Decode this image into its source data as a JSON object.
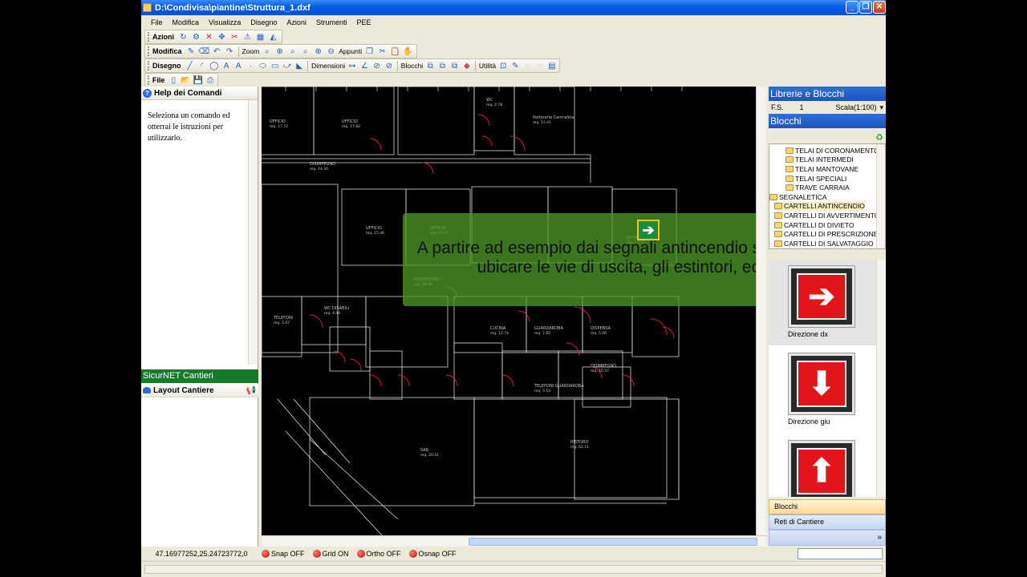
{
  "window": {
    "title": "D:\\Condivisa\\piantine\\Struttura_1.dxf"
  },
  "menu": [
    "File",
    "Modifica",
    "Visualizza",
    "Disegno",
    "Azioni",
    "Strumenti",
    "PEE"
  ],
  "toolbars": {
    "azioni": "Azioni",
    "modifica": "Modifica",
    "zoom": "Zoom",
    "appunti": "Appunti",
    "disegno": "Disegno",
    "dimensioni": "Dimensioni",
    "blocchi": "Blocchi",
    "utilita": "Utilità",
    "file": "File"
  },
  "help": {
    "title": "Help dei Comandi",
    "text": "Seleziona un comando ed otterrai le istruzioni per utilizzarlo."
  },
  "sicurnet": {
    "title": "SicurNET Cantieri",
    "layout": "Layout Cantiere"
  },
  "overlay": {
    "text": "A partire ad esempio dai segnali antincendio si possono ubicare le vie di uscita, gli estintori, ecc."
  },
  "library": {
    "title": "Librerie e Blocchi",
    "fs_label": "F.S.",
    "fs_value": "1",
    "scale": "Scala(1:100)",
    "blocks_title": "Blocchi",
    "tree": [
      {
        "label": "TELAI DI CORONAMENTO",
        "indent": 2
      },
      {
        "label": "TELAI INTERMEDI",
        "indent": 2
      },
      {
        "label": "TELAI MANTOVANE",
        "indent": 2
      },
      {
        "label": "TELAI SPECIALI",
        "indent": 2
      },
      {
        "label": "TRAVE CARRAIA",
        "indent": 2
      },
      {
        "label": "SEGNALETICA",
        "indent": 0
      },
      {
        "label": "CARTELLI ANTINCENDIO",
        "indent": 1,
        "selected": true
      },
      {
        "label": "CARTELLI DI AVVERTIMENTO",
        "indent": 1
      },
      {
        "label": "CARTELLI DI DIVIETO",
        "indent": 1
      },
      {
        "label": "CARTELLI DI PRESCRIZIONE",
        "indent": 1
      },
      {
        "label": "CARTELLI DI SALVATAGGIO",
        "indent": 1
      }
    ],
    "items": [
      {
        "label": "Direzione dx",
        "icon": "arrow-right-icon"
      },
      {
        "label": "Direzione giu",
        "icon": "arrow-down-icon"
      },
      {
        "label": "",
        "icon": "arrow-up-icon"
      }
    ],
    "tab_blocchi": "Blocchi",
    "tab_reti": "Reti di Cantiere"
  },
  "status": {
    "coords": "47.16977252,25.24723772,0",
    "snap": "Snap OFF",
    "grid": "Grid ON",
    "ortho": "Ortho OFF",
    "osnap": "Osnap OFF"
  },
  "cad_labels": [
    {
      "t": "UFFICIO",
      "s": "mq. 17.72"
    },
    {
      "t": "UFFICIO",
      "s": "mq. 17.82"
    },
    {
      "t": "WC",
      "s": "mq. 2.78"
    },
    {
      "t": "Portineria Centralino",
      "s": "mq. 12.41"
    },
    {
      "t": "DISIMPEGNO",
      "s": "mq. 14.30"
    },
    {
      "t": "UFFICIO",
      "s": "mq. 15.46"
    },
    {
      "t": "UFFICIO",
      "s": "mq. 15.15"
    },
    {
      "t": "UFFICIO",
      "s": "mq. 14.61"
    },
    {
      "t": "DISIMPEGNO",
      "s": "mq. 44.46"
    },
    {
      "t": "TELEFONI",
      "s": "mq. 5.07"
    },
    {
      "t": "WC DISABILI",
      "s": "mq. 4.44"
    },
    {
      "t": "CUCINA",
      "s": "mq. 12.74"
    },
    {
      "t": "GUARDAROBA",
      "s": "mq. 7.60"
    },
    {
      "t": "DISPENSA",
      "s": "mq. 5.00"
    },
    {
      "t": "DISIMPEGNO",
      "s": "mq. 10.37"
    },
    {
      "t": "TELEFONI GUARDAROBA",
      "s": "mq. 5.10"
    },
    {
      "t": "SAR",
      "s": "mq. 20.41"
    },
    {
      "t": "RISTORO",
      "s": "mq. 62.11"
    }
  ]
}
